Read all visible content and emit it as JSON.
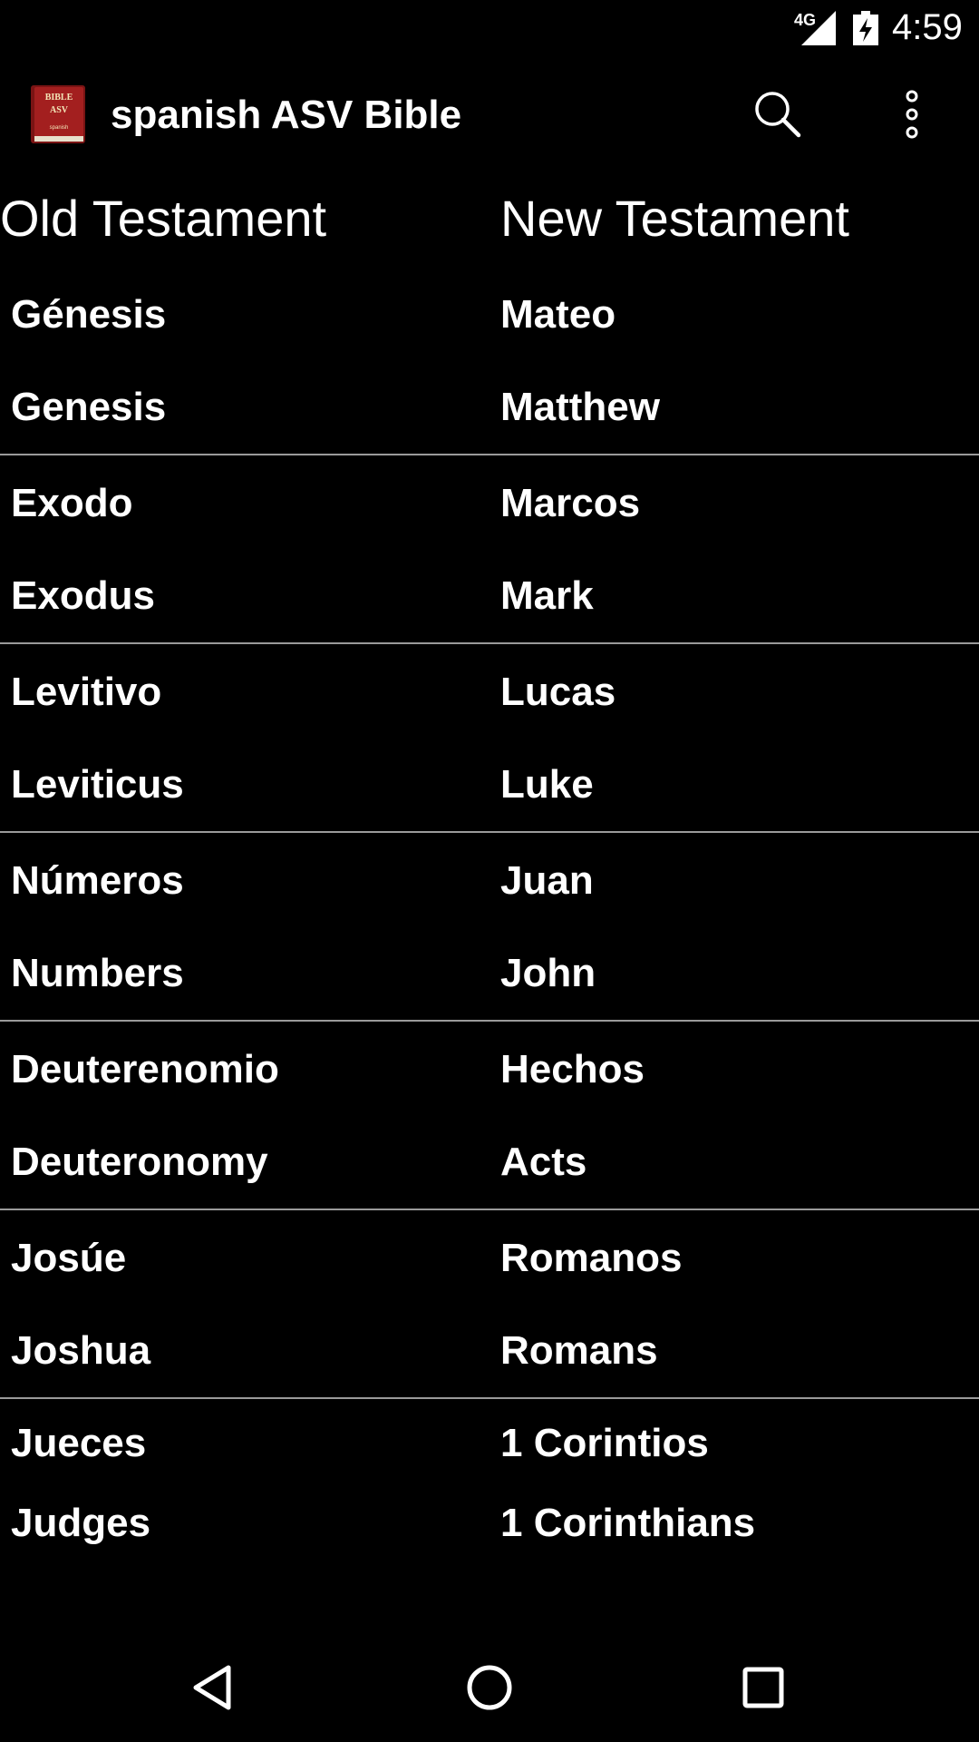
{
  "status_bar": {
    "network": "4G",
    "time": "4:59"
  },
  "app_bar": {
    "title": "spanish ASV Bible",
    "icon_line1": "BIBLE",
    "icon_line2": "ASV",
    "icon_line3": "spanish",
    "icons": {
      "app": "bible-book-icon",
      "search": "search-icon",
      "overflow": "more-vert-icon"
    }
  },
  "columns": {
    "old": "Old Testament",
    "new": "New Testament"
  },
  "books": [
    {
      "old_es": "Génesis",
      "old_en": "Genesis",
      "new_es": "Mateo",
      "new_en": "Matthew"
    },
    {
      "old_es": "Exodo",
      "old_en": "Exodus",
      "new_es": "Marcos",
      "new_en": "Mark"
    },
    {
      "old_es": "Levitivo",
      "old_en": "Leviticus",
      "new_es": "Lucas",
      "new_en": "Luke"
    },
    {
      "old_es": "Números",
      "old_en": "Numbers",
      "new_es": "Juan",
      "new_en": "John"
    },
    {
      "old_es": "Deuterenomio",
      "old_en": "Deuteronomy",
      "new_es": "Hechos",
      "new_en": "Acts"
    },
    {
      "old_es": "Josúe",
      "old_en": "Joshua",
      "new_es": "Romanos",
      "new_en": "Romans"
    },
    {
      "old_es": "Jueces",
      "old_en": "Judges",
      "new_es": "1 Corintios",
      "new_en": "1 Corinthians"
    }
  ],
  "nav_bar": {
    "icons": {
      "back": "back-triangle-icon",
      "home": "home-circle-icon",
      "recents": "recents-square-icon"
    }
  },
  "colors": {
    "background": "#000000",
    "text": "#ffffff",
    "divider": "#9a9a9a",
    "app_icon_red": "#a31f1f"
  }
}
